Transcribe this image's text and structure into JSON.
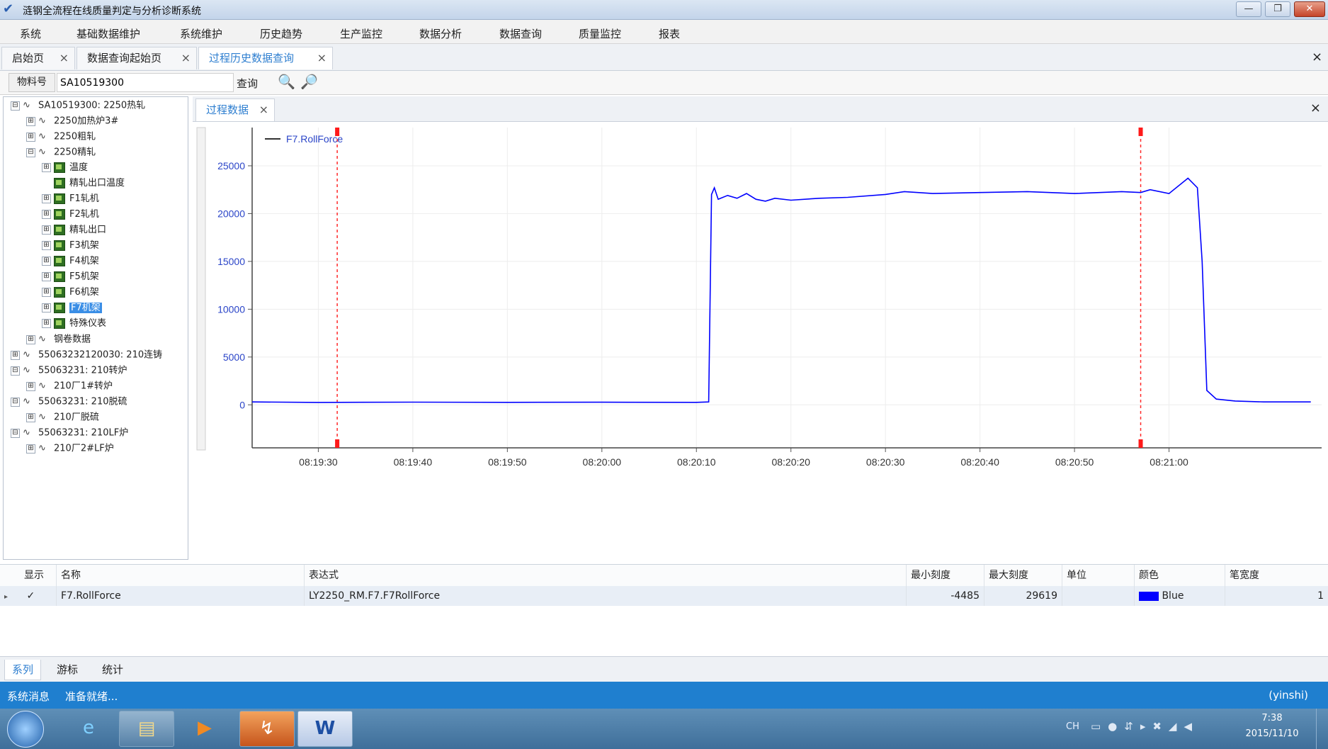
{
  "window": {
    "title": "涟钢全流程在线质量判定与分析诊断系统"
  },
  "menu": [
    "系统",
    "基础数据维护",
    "系统维护",
    "历史趋势",
    "生产监控",
    "数据分析",
    "数据查询",
    "质量监控",
    "报表"
  ],
  "doc_tabs": [
    {
      "label": "启始页"
    },
    {
      "label": "数据查询起始页"
    },
    {
      "label": "过程历史数据查询"
    }
  ],
  "toolbar": {
    "field_label": "物料号",
    "field_value": "SA10519300",
    "query_button": "查询"
  },
  "tree": [
    {
      "exp": "⊟",
      "level": 0,
      "kind": "wave",
      "label": "SA10519300: 2250热轧"
    },
    {
      "exp": "⊞",
      "level": 1,
      "kind": "wave",
      "label": "2250加热炉3#"
    },
    {
      "exp": "⊞",
      "level": 1,
      "kind": "wave",
      "label": "2250粗轧"
    },
    {
      "exp": "⊟",
      "level": 1,
      "kind": "wave",
      "label": "2250精轧"
    },
    {
      "exp": "⊞",
      "level": 2,
      "kind": "folder",
      "label": "温度"
    },
    {
      "exp": "",
      "level": 2,
      "kind": "folder",
      "label": "精轧出口温度"
    },
    {
      "exp": "⊞",
      "level": 2,
      "kind": "folder",
      "label": "F1轧机"
    },
    {
      "exp": "⊞",
      "level": 2,
      "kind": "folder",
      "label": "F2轧机"
    },
    {
      "exp": "⊞",
      "level": 2,
      "kind": "folder",
      "label": "精轧出口"
    },
    {
      "exp": "⊞",
      "level": 2,
      "kind": "folder",
      "label": "F3机架"
    },
    {
      "exp": "⊞",
      "level": 2,
      "kind": "folder",
      "label": "F4机架"
    },
    {
      "exp": "⊞",
      "level": 2,
      "kind": "folder",
      "label": "F5机架"
    },
    {
      "exp": "⊞",
      "level": 2,
      "kind": "folder",
      "label": "F6机架"
    },
    {
      "exp": "⊞",
      "level": 2,
      "kind": "folder",
      "label": "F7机架",
      "selected": true
    },
    {
      "exp": "⊞",
      "level": 2,
      "kind": "folder",
      "label": "特殊仪表"
    },
    {
      "exp": "⊞",
      "level": 1,
      "kind": "wave",
      "label": "钢卷数据"
    },
    {
      "exp": "⊞",
      "level": 0,
      "kind": "wave",
      "label": "55063232120030: 210连铸"
    },
    {
      "exp": "⊟",
      "level": 0,
      "kind": "wave",
      "label": "55063231: 210转炉"
    },
    {
      "exp": "⊞",
      "level": 1,
      "kind": "wave",
      "label": "210厂1#转炉"
    },
    {
      "exp": "⊟",
      "level": 0,
      "kind": "wave",
      "label": "55063231: 210脱硫"
    },
    {
      "exp": "⊞",
      "level": 1,
      "kind": "wave",
      "label": "210厂脱硫"
    },
    {
      "exp": "⊟",
      "level": 0,
      "kind": "wave",
      "label": "55063231: 210LF炉"
    },
    {
      "exp": "⊞",
      "level": 1,
      "kind": "wave",
      "label": "210厂2#LF炉"
    }
  ],
  "chart_tab": {
    "label": "过程数据"
  },
  "chart_data": {
    "type": "line",
    "series": [
      {
        "name": "F7.RollForce",
        "color": "#0000ff"
      }
    ],
    "x_ticks": [
      "08:19:30",
      "08:19:40",
      "08:19:50",
      "08:20:00",
      "08:20:10",
      "08:20:20",
      "08:20:30",
      "08:20:40",
      "08:20:50",
      "08:21:00"
    ],
    "y_ticks": [
      "0",
      "5000",
      "10000",
      "15000",
      "20000",
      "25000"
    ],
    "ylim": [
      -4500,
      29000
    ],
    "xlim_seconds": [
      -7,
      92
    ],
    "cursors_seconds": [
      2,
      87
    ],
    "points": [
      [
        -7,
        300
      ],
      [
        0,
        250
      ],
      [
        10,
        280
      ],
      [
        20,
        260
      ],
      [
        30,
        270
      ],
      [
        40,
        260
      ],
      [
        41.3,
        300
      ],
      [
        41.6,
        22000
      ],
      [
        41.9,
        22700
      ],
      [
        42.3,
        21500
      ],
      [
        43.3,
        21900
      ],
      [
        44.3,
        21600
      ],
      [
        45.3,
        22100
      ],
      [
        46.3,
        21500
      ],
      [
        47.3,
        21300
      ],
      [
        48.3,
        21600
      ],
      [
        50,
        21400
      ],
      [
        53,
        21600
      ],
      [
        56,
        21700
      ],
      [
        60,
        22000
      ],
      [
        62,
        22300
      ],
      [
        65,
        22100
      ],
      [
        70,
        22200
      ],
      [
        75,
        22300
      ],
      [
        80,
        22100
      ],
      [
        85,
        22300
      ],
      [
        87,
        22200
      ],
      [
        88,
        22500
      ],
      [
        90,
        22100
      ],
      [
        92,
        23700
      ],
      [
        93,
        22700
      ],
      [
        93.5,
        15000
      ],
      [
        94,
        1500
      ],
      [
        95,
        600
      ],
      [
        97,
        400
      ],
      [
        100,
        300
      ],
      [
        105,
        300
      ]
    ]
  },
  "grid": {
    "headers": [
      "显示",
      "名称",
      "表达式",
      "最小刻度",
      "最大刻度",
      "单位",
      "颜色",
      "笔宽度"
    ],
    "rows": [
      {
        "show": "✓",
        "name": "F7.RollForce",
        "expression": "LY2250_RM.F7.F7RollForce",
        "min": "-4485",
        "max": "29619",
        "unit": "",
        "color_label": "Blue",
        "color": "#0000ff",
        "width": "1"
      }
    ]
  },
  "bottom_tabs": [
    "系列",
    "游标",
    "统计"
  ],
  "status": {
    "label": "系统消息",
    "message": "准备就绪...",
    "user": "(yinshi)"
  },
  "taskbar": {
    "time": "7:38",
    "date": "2015/11/10",
    "lang": "CH"
  }
}
